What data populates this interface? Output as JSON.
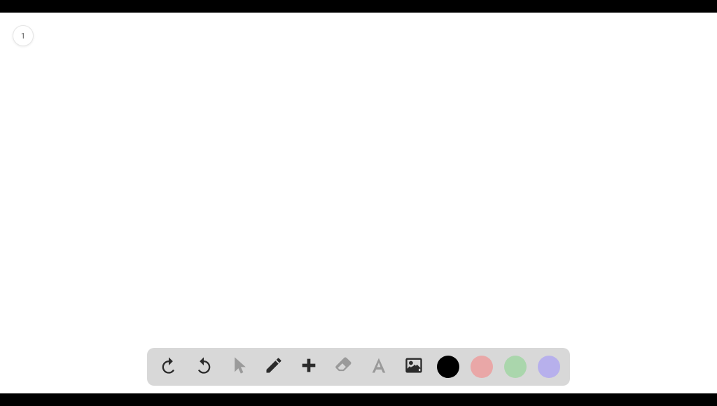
{
  "page_badge": {
    "number": "1"
  },
  "toolbar": {
    "tools": {
      "undo": "undo",
      "redo": "redo",
      "pointer": "pointer",
      "pencil": "pencil",
      "plus": "plus",
      "eraser": "eraser",
      "text": "text",
      "image": "image"
    },
    "swatches": [
      {
        "name": "black",
        "hex": "#000000"
      },
      {
        "name": "pink",
        "hex": "#e9a7a7"
      },
      {
        "name": "green",
        "hex": "#aad6ac"
      },
      {
        "name": "lavender",
        "hex": "#b7b0ec"
      }
    ]
  }
}
